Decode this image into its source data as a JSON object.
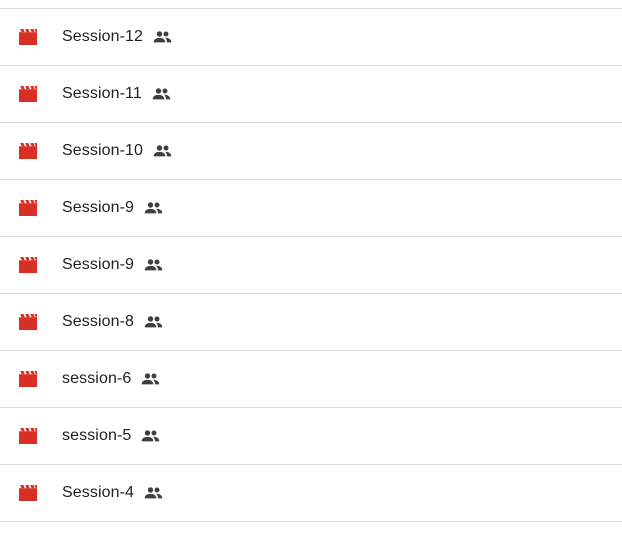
{
  "file_list": {
    "items": [
      {
        "name": "Session-12",
        "file_icon": "video-icon",
        "status_icon": "shared-people-icon"
      },
      {
        "name": "Session-11",
        "file_icon": "video-icon",
        "status_icon": "shared-people-icon"
      },
      {
        "name": "Session-10",
        "file_icon": "video-icon",
        "status_icon": "shared-people-icon"
      },
      {
        "name": "Session-9",
        "file_icon": "video-icon",
        "status_icon": "shared-people-icon"
      },
      {
        "name": "Session-9",
        "file_icon": "video-icon",
        "status_icon": "shared-people-icon"
      },
      {
        "name": "Session-8",
        "file_icon": "video-icon",
        "status_icon": "shared-people-icon"
      },
      {
        "name": "session-6",
        "file_icon": "video-icon",
        "status_icon": "shared-people-icon"
      },
      {
        "name": "session-5",
        "file_icon": "video-icon",
        "status_icon": "shared-people-icon"
      },
      {
        "name": "Session-4",
        "file_icon": "video-icon",
        "status_icon": "shared-people-icon"
      }
    ]
  },
  "colors": {
    "video_icon": "#d93025",
    "shared_icon": "#3c4043",
    "divider": "#dadce0",
    "text": "#202124"
  }
}
